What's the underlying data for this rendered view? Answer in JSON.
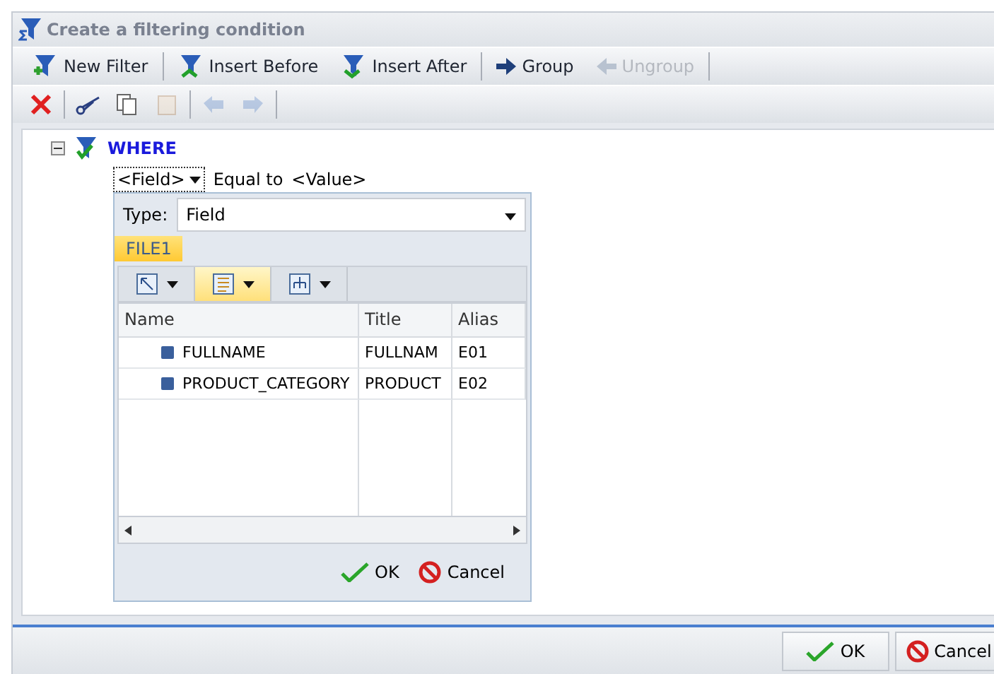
{
  "window": {
    "title": "Create a filtering condition"
  },
  "toolbar": [
    {
      "kind": "new",
      "label": "New Filter",
      "disabled": false
    },
    {
      "kind": "before",
      "label": "Insert Before",
      "disabled": false
    },
    {
      "kind": "after",
      "label": "Insert After",
      "disabled": false
    },
    {
      "kind": "group",
      "label": "Group",
      "disabled": false
    },
    {
      "kind": "ungroup",
      "label": "Ungroup",
      "disabled": true
    }
  ],
  "edit_toolbar": [
    {
      "kind": "delete",
      "disabled": false
    },
    {
      "kind": "cut",
      "disabled": false
    },
    {
      "kind": "copy",
      "disabled": false
    },
    {
      "kind": "paste",
      "disabled": true
    },
    {
      "kind": "undo",
      "disabled": true
    },
    {
      "kind": "redo",
      "disabled": true
    }
  ],
  "tree": {
    "label": "WHERE",
    "expanded": true,
    "condition": {
      "field": "<Field>",
      "operator": "Equal to",
      "value": "<Value>"
    }
  },
  "picker": {
    "type_label": "Type:",
    "type_value": "Field",
    "tabs": [
      {
        "label": "FILE1",
        "selected": true
      }
    ],
    "views": [
      {
        "kind": "diagram",
        "selected": false
      },
      {
        "kind": "list",
        "selected": true
      },
      {
        "kind": "tree",
        "selected": false
      }
    ],
    "columns": [
      "Name",
      "Title",
      "Alias"
    ],
    "rows": [
      {
        "name": "FULLNAME",
        "title": "FULLNAM",
        "alias": "E01"
      },
      {
        "name": "PRODUCT_CATEGORY",
        "title": "PRODUCT",
        "alias": "E02"
      }
    ],
    "ok": "OK",
    "cancel": "Cancel"
  },
  "buttons": {
    "ok": "OK",
    "cancel": "Cancel"
  }
}
